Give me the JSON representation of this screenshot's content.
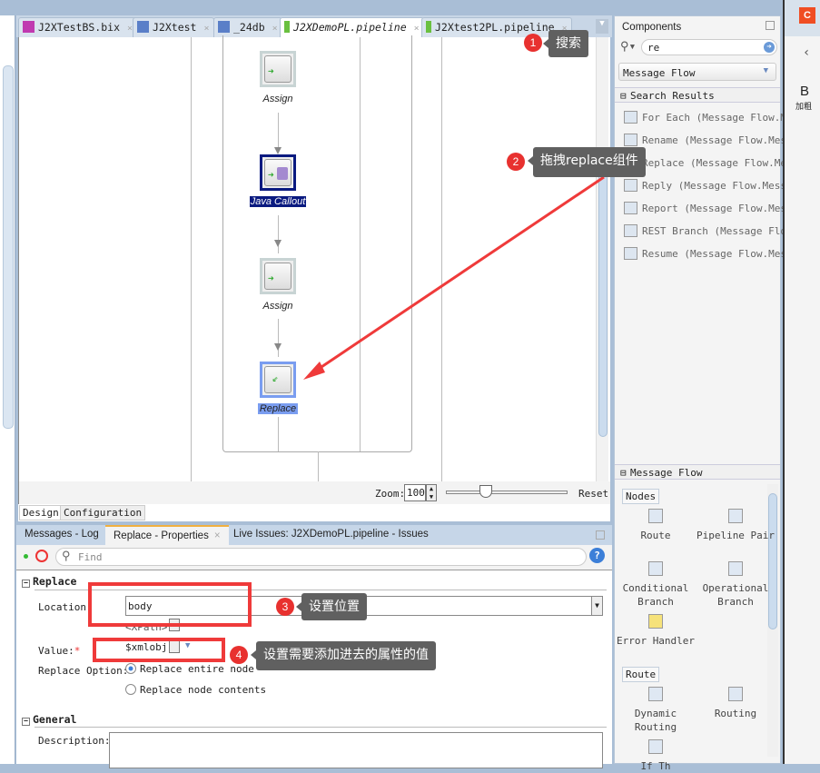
{
  "editor_tabs": [
    {
      "label": "J2XTestBS.bix",
      "icon": "business-service-icon"
    },
    {
      "label": "J2Xtest",
      "icon": "composite-icon"
    },
    {
      "label": "_24db",
      "icon": "composite-icon"
    },
    {
      "label": "J2XDemoPL.pipeline",
      "icon": "pipeline-icon",
      "active": true
    },
    {
      "label": "J2Xtest2PL.pipeline",
      "icon": "pipeline-icon"
    }
  ],
  "canvas": {
    "nodes": [
      {
        "label": "Assign",
        "icon": "assign-icon"
      },
      {
        "label": "Java Callout",
        "icon": "java-callout-icon",
        "state": "selected"
      },
      {
        "label": "Assign",
        "icon": "assign-icon"
      },
      {
        "label": "Replace",
        "icon": "replace-icon",
        "state": "highlighted"
      }
    ]
  },
  "zoom": {
    "label": "Zoom:",
    "value": "100",
    "slider_percent": 35,
    "reset": "Reset"
  },
  "design_tabs": [
    "Design",
    "Configuration"
  ],
  "bottom_tabs": [
    "Messages - Log",
    "Replace - Properties",
    "Live Issues: J2XDemoPL.pipeline - Issues"
  ],
  "properties": {
    "find_placeholder": "Find",
    "replace_section": "Replace",
    "location_label": "Location:",
    "location_value": "body",
    "xpath_hint": "<XPath>",
    "value_label": "Value:",
    "required_mark": "*",
    "value_value": "$xmlobj",
    "option_label": "Replace Option:",
    "options": [
      "Replace entire node",
      "Replace node contents"
    ],
    "selected_option": 0,
    "general_section": "General",
    "description_label": "Description:"
  },
  "components": {
    "title": "Components",
    "search_value": "re",
    "category": "Message Flow",
    "search_results_label": "Search Results",
    "results": [
      "For Each (Message Flow.Mes",
      "Rename (Message Flow.Messa",
      "Replace (Message Flow.Messa",
      "Reply (Message Flow.Messag",
      "Report (Message Flow.Messa",
      "REST Branch (Message Flow.",
      "Resume (Message Flow.Messa"
    ],
    "palette_label": "Message Flow",
    "nodes_group": "Nodes",
    "nodes": [
      "Route",
      "Pipeline Pair",
      "Conditional Branch",
      "Operational Branch",
      "Error Handler"
    ],
    "route_group": "Route",
    "route_items": [
      "Dynamic Routing",
      "Routing",
      "If Th"
    ]
  },
  "right_strip": {
    "bold_label": "B",
    "bold_caption": "加粗",
    "logo": "C"
  },
  "annotations": [
    {
      "num": "1",
      "text": "搜索"
    },
    {
      "num": "2",
      "text": "拖拽replace组件"
    },
    {
      "num": "3",
      "text": "设置位置"
    },
    {
      "num": "4",
      "text": "设置需要添加进去的属性的值"
    }
  ],
  "colors": {
    "annotation_red": "#e8312f",
    "selection_navy": "#0a1a80",
    "highlight_blue": "#7a9df0"
  }
}
